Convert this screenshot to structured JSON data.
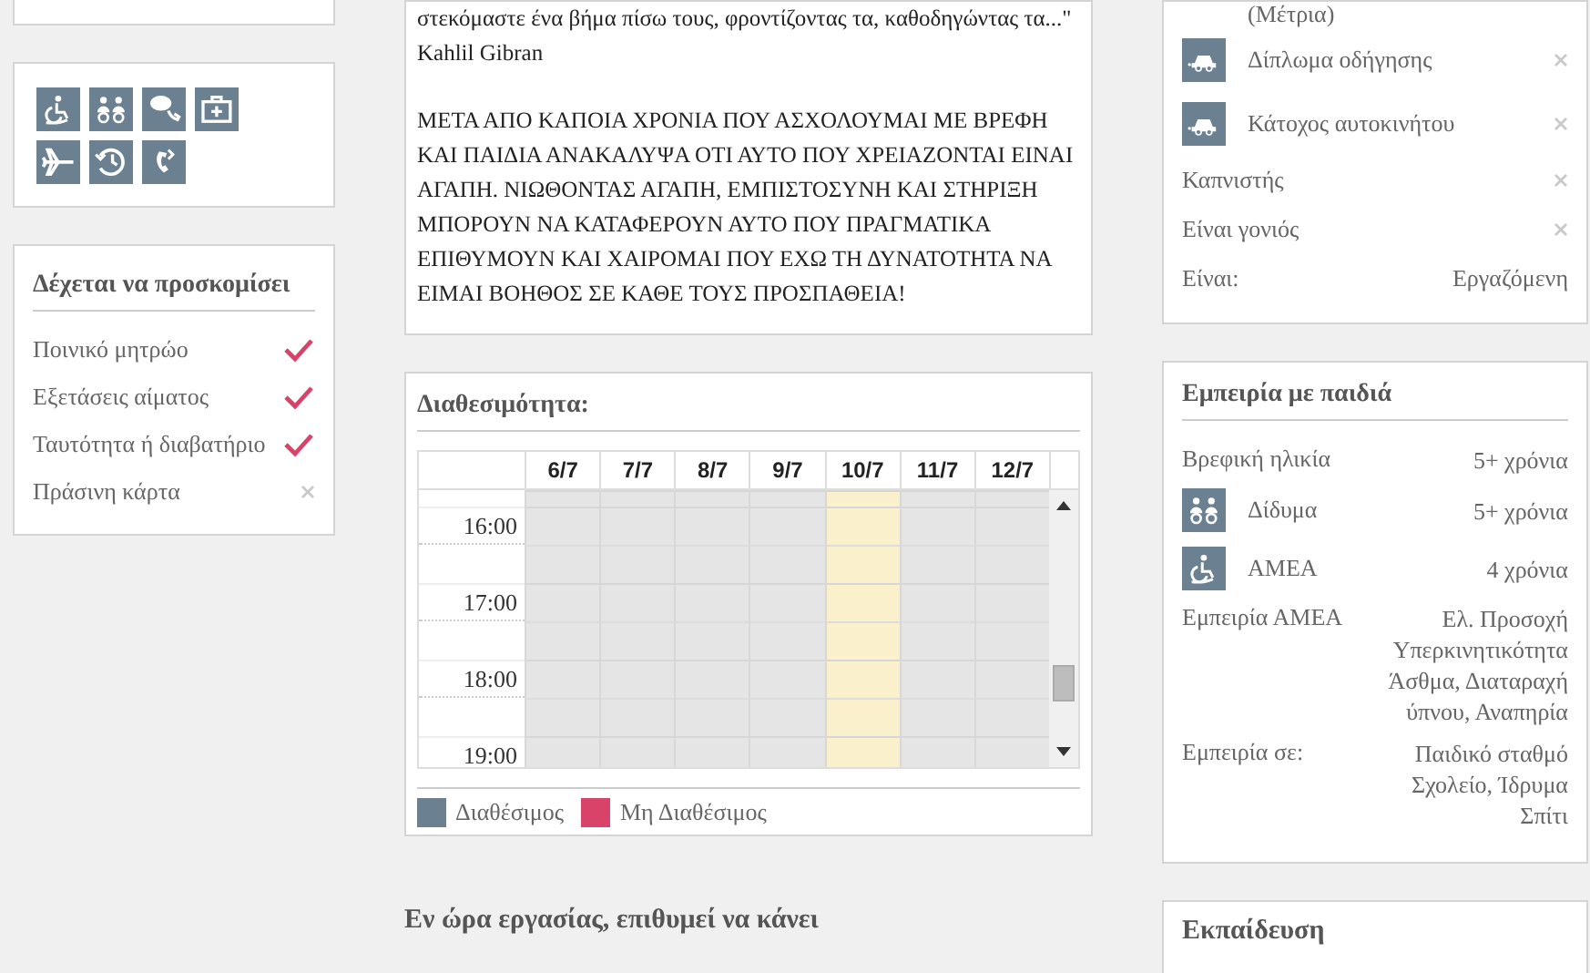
{
  "accepts": {
    "title": "Δέχεται να προσκομίσει",
    "items": [
      {
        "label": "Ποινικό μητρώο",
        "checked": true
      },
      {
        "label": "Εξετάσεις αίματος",
        "checked": true
      },
      {
        "label": "Ταυτότητα ή διαβατήριο",
        "checked": true
      },
      {
        "label": "Πράσινη κάρτα",
        "checked": false
      }
    ]
  },
  "about": {
    "quote": "στεκόμαστε ένα βήμα πίσω τους, φροντίζοντας τα, καθοδηγώντας τα...\"",
    "author": "Kahlil Gibran",
    "text": "ΜΕΤΑ ΑΠΟ ΚΑΠΟΙΑ ΧΡΟΝΙΑ ΠΟΥ ΑΣΧΟΛΟΥΜΑΙ ΜΕ ΒΡΕΦΗ ΚΑΙ ΠΑΙΔΙΑ ΑΝΑΚΑΛΥΨΑ ΟΤΙ ΑΥΤΟ ΠΟΥ ΧΡΕΙΑΖΟΝΤΑΙ ΕΙΝΑΙ ΑΓΑΠΗ. ΝΙΩΘΟΝΤΑΣ ΑΓΑΠΗ, ΕΜΠΙΣΤΟΣΥΝΗ ΚΑΙ ΣΤΗΡΙΞΗ ΜΠΟΡΟΥΝ ΝΑ ΚΑΤΑΦΕΡΟΥΝ ΑΥΤΟ ΠΟΥ ΠΡΑΓΜΑΤΙΚΑ ΕΠΙΘΥΜΟΥΝ ΚΑΙ ΧΑΙΡΟΜΑΙ ΠΟΥ ΕΧΩ ΤΗ ΔΥΝΑΤΟΤΗΤΑ ΝΑ ΕΙΜΑΙ ΒΟΗΘΟΣ ΣΕ ΚΑΘΕ ΤΟΥΣ ΠΡΟΣΠΑΘΕΙΑ!"
  },
  "availability": {
    "title": "Διαθεσιμότητα:",
    "days": [
      {
        "label": "6/7",
        "today": false
      },
      {
        "label": "7/7",
        "today": false
      },
      {
        "label": "8/7",
        "today": false
      },
      {
        "label": "9/7",
        "today": false
      },
      {
        "label": "10/7",
        "today": true
      },
      {
        "label": "11/7",
        "today": false
      },
      {
        "label": "12/7",
        "today": false
      }
    ],
    "times": [
      "16:00",
      "17:00",
      "18:00",
      "19:00"
    ],
    "legend": [
      {
        "label": "Διαθέσιμος",
        "color": "#6b8191"
      },
      {
        "label": "Μη Διαθέσιμος",
        "color": "#d9436a"
      }
    ]
  },
  "next_section": {
    "title": "Εν ώρα εργασίας, επιθυμεί να κάνει"
  },
  "profile": {
    "note": "(Μέτρια)",
    "rows": [
      {
        "kind": "car",
        "label": "Δίπλωμα οδήγησης",
        "checked": false
      },
      {
        "kind": "car",
        "label": "Κάτοχος αυτοκινήτου",
        "checked": false
      },
      {
        "kind": "plain",
        "label": "Καπνιστής",
        "checked": false
      },
      {
        "kind": "plain",
        "label": "Είναι γονιός",
        "checked": false
      },
      {
        "kind": "value",
        "label": "Είναι:",
        "value": "Εργαζόμενη"
      }
    ]
  },
  "experience": {
    "title": "Εμπειρία με παιδιά",
    "rows": [
      {
        "kind": "plain",
        "label": "Βρεφική ηλικία",
        "value": [
          "5+ χρόνια"
        ]
      },
      {
        "kind": "twins",
        "label": "Δίδυμα",
        "value": [
          "5+ χρόνια"
        ]
      },
      {
        "kind": "wheelchair",
        "label": "ΑΜΕΑ",
        "value": [
          "4 χρόνια"
        ]
      },
      {
        "kind": "plain",
        "label": "Εμπειρία ΑΜΕΑ",
        "value": [
          "Ελ. Προσοχή",
          "Υπερκινητικότητα",
          "Άσθμα, Διαταραχή",
          "ύπνου, Αναπηρία"
        ]
      },
      {
        "kind": "plain",
        "label": "Εμπειρία σε:",
        "value": [
          "Παιδικό σταθμό",
          "Σχολείο, Ίδρυμα",
          "Σπίτι"
        ]
      }
    ]
  },
  "education": {
    "title": "Εκπαίδευση"
  }
}
